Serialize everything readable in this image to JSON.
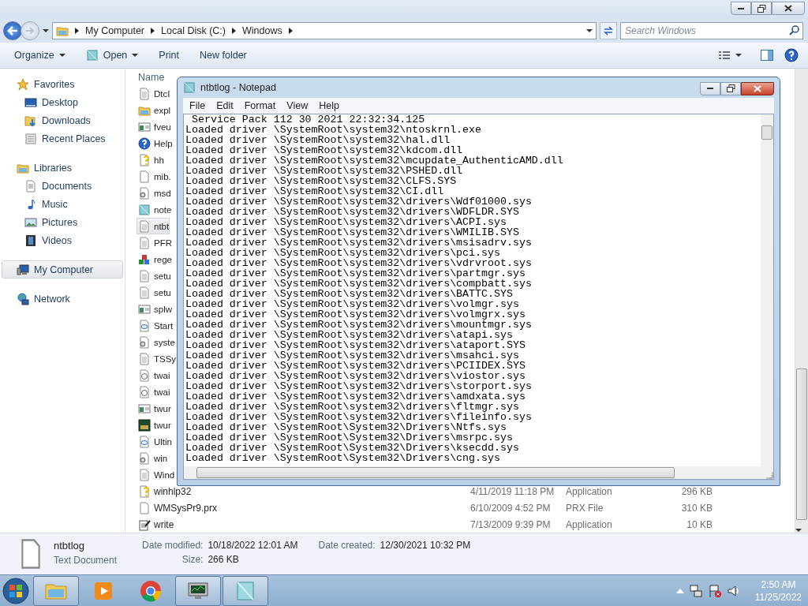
{
  "explorer": {
    "address": {
      "crumbs": [
        "My Computer",
        "Local Disk (C:)",
        "Windows"
      ]
    },
    "search": {
      "placeholder": "Search Windows"
    },
    "toolbar": [
      {
        "label": "Organize",
        "kind": "menu"
      },
      {
        "label": "Open",
        "kind": "open"
      },
      {
        "label": "Print",
        "kind": "plain"
      },
      {
        "label": "New folder",
        "kind": "plain"
      }
    ],
    "sidebar": [
      {
        "label": "Favorites",
        "kind": "star",
        "selected": false,
        "children": [
          {
            "label": "Desktop",
            "kind": "desktop",
            "selected": false
          },
          {
            "label": "Downloads",
            "kind": "downloads",
            "selected": false
          },
          {
            "label": "Recent Places",
            "kind": "recent",
            "selected": false
          }
        ]
      },
      {
        "label": "Libraries",
        "kind": "libraries",
        "selected": false,
        "children": [
          {
            "label": "Documents",
            "kind": "documents",
            "selected": false
          },
          {
            "label": "Music",
            "kind": "music",
            "selected": false
          },
          {
            "label": "Pictures",
            "kind": "pictures",
            "selected": false
          },
          {
            "label": "Videos",
            "kind": "videos",
            "selected": false
          }
        ]
      },
      {
        "label": "My Computer",
        "kind": "computer",
        "selected": true
      },
      {
        "label": "Network",
        "kind": "network",
        "selected": false
      }
    ],
    "file_list": {
      "columns": [
        "Name"
      ],
      "rows": [
        {
          "name": "DtcI",
          "kind": "text",
          "selected": false
        },
        {
          "name": "expl",
          "kind": "folder",
          "selected": false
        },
        {
          "name": "fveu",
          "kind": "app",
          "selected": false
        },
        {
          "name": "Help",
          "kind": "help",
          "selected": false
        },
        {
          "name": "hh",
          "kind": "helpdoc",
          "selected": false
        },
        {
          "name": "mib.",
          "kind": "blank",
          "selected": false
        },
        {
          "name": "msd",
          "kind": "gear",
          "selected": false
        },
        {
          "name": "note",
          "kind": "notepad",
          "selected": false
        },
        {
          "name": "ntbt",
          "kind": "text",
          "selected": true
        },
        {
          "name": "PFR",
          "kind": "text",
          "selected": false
        },
        {
          "name": "rege",
          "kind": "reg",
          "selected": false
        },
        {
          "name": "setu",
          "kind": "text",
          "selected": false
        },
        {
          "name": "setu",
          "kind": "text",
          "selected": false
        },
        {
          "name": "splw",
          "kind": "app",
          "selected": false
        },
        {
          "name": "Start",
          "kind": "xml",
          "selected": false
        },
        {
          "name": "syste",
          "kind": "gear",
          "selected": false
        },
        {
          "name": "TSSy",
          "kind": "text",
          "selected": false
        },
        {
          "name": "twai",
          "kind": "link",
          "selected": false
        },
        {
          "name": "twai",
          "kind": "link",
          "selected": false
        },
        {
          "name": "twur",
          "kind": "app",
          "selected": false
        },
        {
          "name": "twur",
          "kind": "scanner",
          "selected": false
        },
        {
          "name": "Ultin",
          "kind": "xml",
          "selected": false
        },
        {
          "name": "win",
          "kind": "gear",
          "selected": false
        },
        {
          "name": "Wind",
          "kind": "text",
          "selected": false
        },
        {
          "name": "winhlp32",
          "kind": "helpdoc",
          "selected": false,
          "date": "4/11/2019 11:18 PM",
          "type": "Application",
          "size": "296 KB"
        },
        {
          "name": "WMSysPr9.prx",
          "kind": "blank",
          "selected": false,
          "date": "6/10/2009 4:52 PM",
          "type": "PRX File",
          "size": "310 KB"
        },
        {
          "name": "write",
          "kind": "write",
          "selected": false,
          "date": "7/13/2009 9:39 PM",
          "type": "Application",
          "size": "10 KB"
        }
      ]
    },
    "details": {
      "name": "ntbtlog",
      "type": "Text Document",
      "fields": [
        {
          "label": "Date modified:",
          "value": "10/18/2022 12:01 AM"
        },
        {
          "label": "Date created:",
          "value": "12/30/2021 10:32 PM"
        },
        {
          "label": "Size:",
          "value": "266 KB"
        }
      ]
    }
  },
  "notepad": {
    "title": "ntbtlog - Notepad",
    "menu": [
      "File",
      "Edit",
      "Format",
      "View",
      "Help"
    ],
    "lines": [
      " Service Pack 112 30 2021 22:32:34.125",
      "Loaded driver \\SystemRoot\\system32\\ntoskrnl.exe",
      "Loaded driver \\SystemRoot\\system32\\hal.dll",
      "Loaded driver \\SystemRoot\\system32\\kdcom.dll",
      "Loaded driver \\SystemRoot\\system32\\mcupdate_AuthenticAMD.dll",
      "Loaded driver \\SystemRoot\\system32\\PSHED.dll",
      "Loaded driver \\SystemRoot\\system32\\CLFS.SYS",
      "Loaded driver \\SystemRoot\\system32\\CI.dll",
      "Loaded driver \\SystemRoot\\system32\\drivers\\Wdf01000.sys",
      "Loaded driver \\SystemRoot\\system32\\drivers\\WDFLDR.SYS",
      "Loaded driver \\SystemRoot\\system32\\drivers\\ACPI.sys",
      "Loaded driver \\SystemRoot\\system32\\drivers\\WMILIB.SYS",
      "Loaded driver \\SystemRoot\\system32\\drivers\\msisadrv.sys",
      "Loaded driver \\SystemRoot\\system32\\drivers\\pci.sys",
      "Loaded driver \\SystemRoot\\system32\\drivers\\vdrvroot.sys",
      "Loaded driver \\SystemRoot\\system32\\drivers\\partmgr.sys",
      "Loaded driver \\SystemRoot\\system32\\drivers\\compbatt.sys",
      "Loaded driver \\SystemRoot\\system32\\drivers\\BATTC.SYS",
      "Loaded driver \\SystemRoot\\system32\\drivers\\volmgr.sys",
      "Loaded driver \\SystemRoot\\system32\\drivers\\volmgrx.sys",
      "Loaded driver \\SystemRoot\\system32\\drivers\\mountmgr.sys",
      "Loaded driver \\SystemRoot\\system32\\drivers\\atapi.sys",
      "Loaded driver \\SystemRoot\\system32\\drivers\\ataport.SYS",
      "Loaded driver \\SystemRoot\\system32\\drivers\\msahci.sys",
      "Loaded driver \\SystemRoot\\system32\\drivers\\PCIIDEX.SYS",
      "Loaded driver \\SystemRoot\\system32\\drivers\\viostor.sys",
      "Loaded driver \\SystemRoot\\system32\\drivers\\storport.sys",
      "Loaded driver \\SystemRoot\\system32\\drivers\\amdxata.sys",
      "Loaded driver \\SystemRoot\\system32\\drivers\\fltmgr.sys",
      "Loaded driver \\SystemRoot\\system32\\drivers\\fileinfo.sys",
      "Loaded driver \\SystemRoot\\System32\\Drivers\\Ntfs.sys",
      "Loaded driver \\SystemRoot\\System32\\Drivers\\msrpc.sys",
      "Loaded driver \\SystemRoot\\System32\\Drivers\\ksecdd.sys",
      "Loaded driver \\SystemRoot\\System32\\Drivers\\cng.sys"
    ]
  },
  "taskbar": {
    "apps": [
      {
        "kind": "explorer",
        "active": true
      },
      {
        "kind": "media",
        "active": false
      },
      {
        "kind": "chrome",
        "active": false
      },
      {
        "kind": "monitor",
        "active": true
      },
      {
        "kind": "notepad",
        "active": true
      }
    ],
    "clock": {
      "time": "2:50 AM",
      "date": "11/25/2022"
    }
  }
}
